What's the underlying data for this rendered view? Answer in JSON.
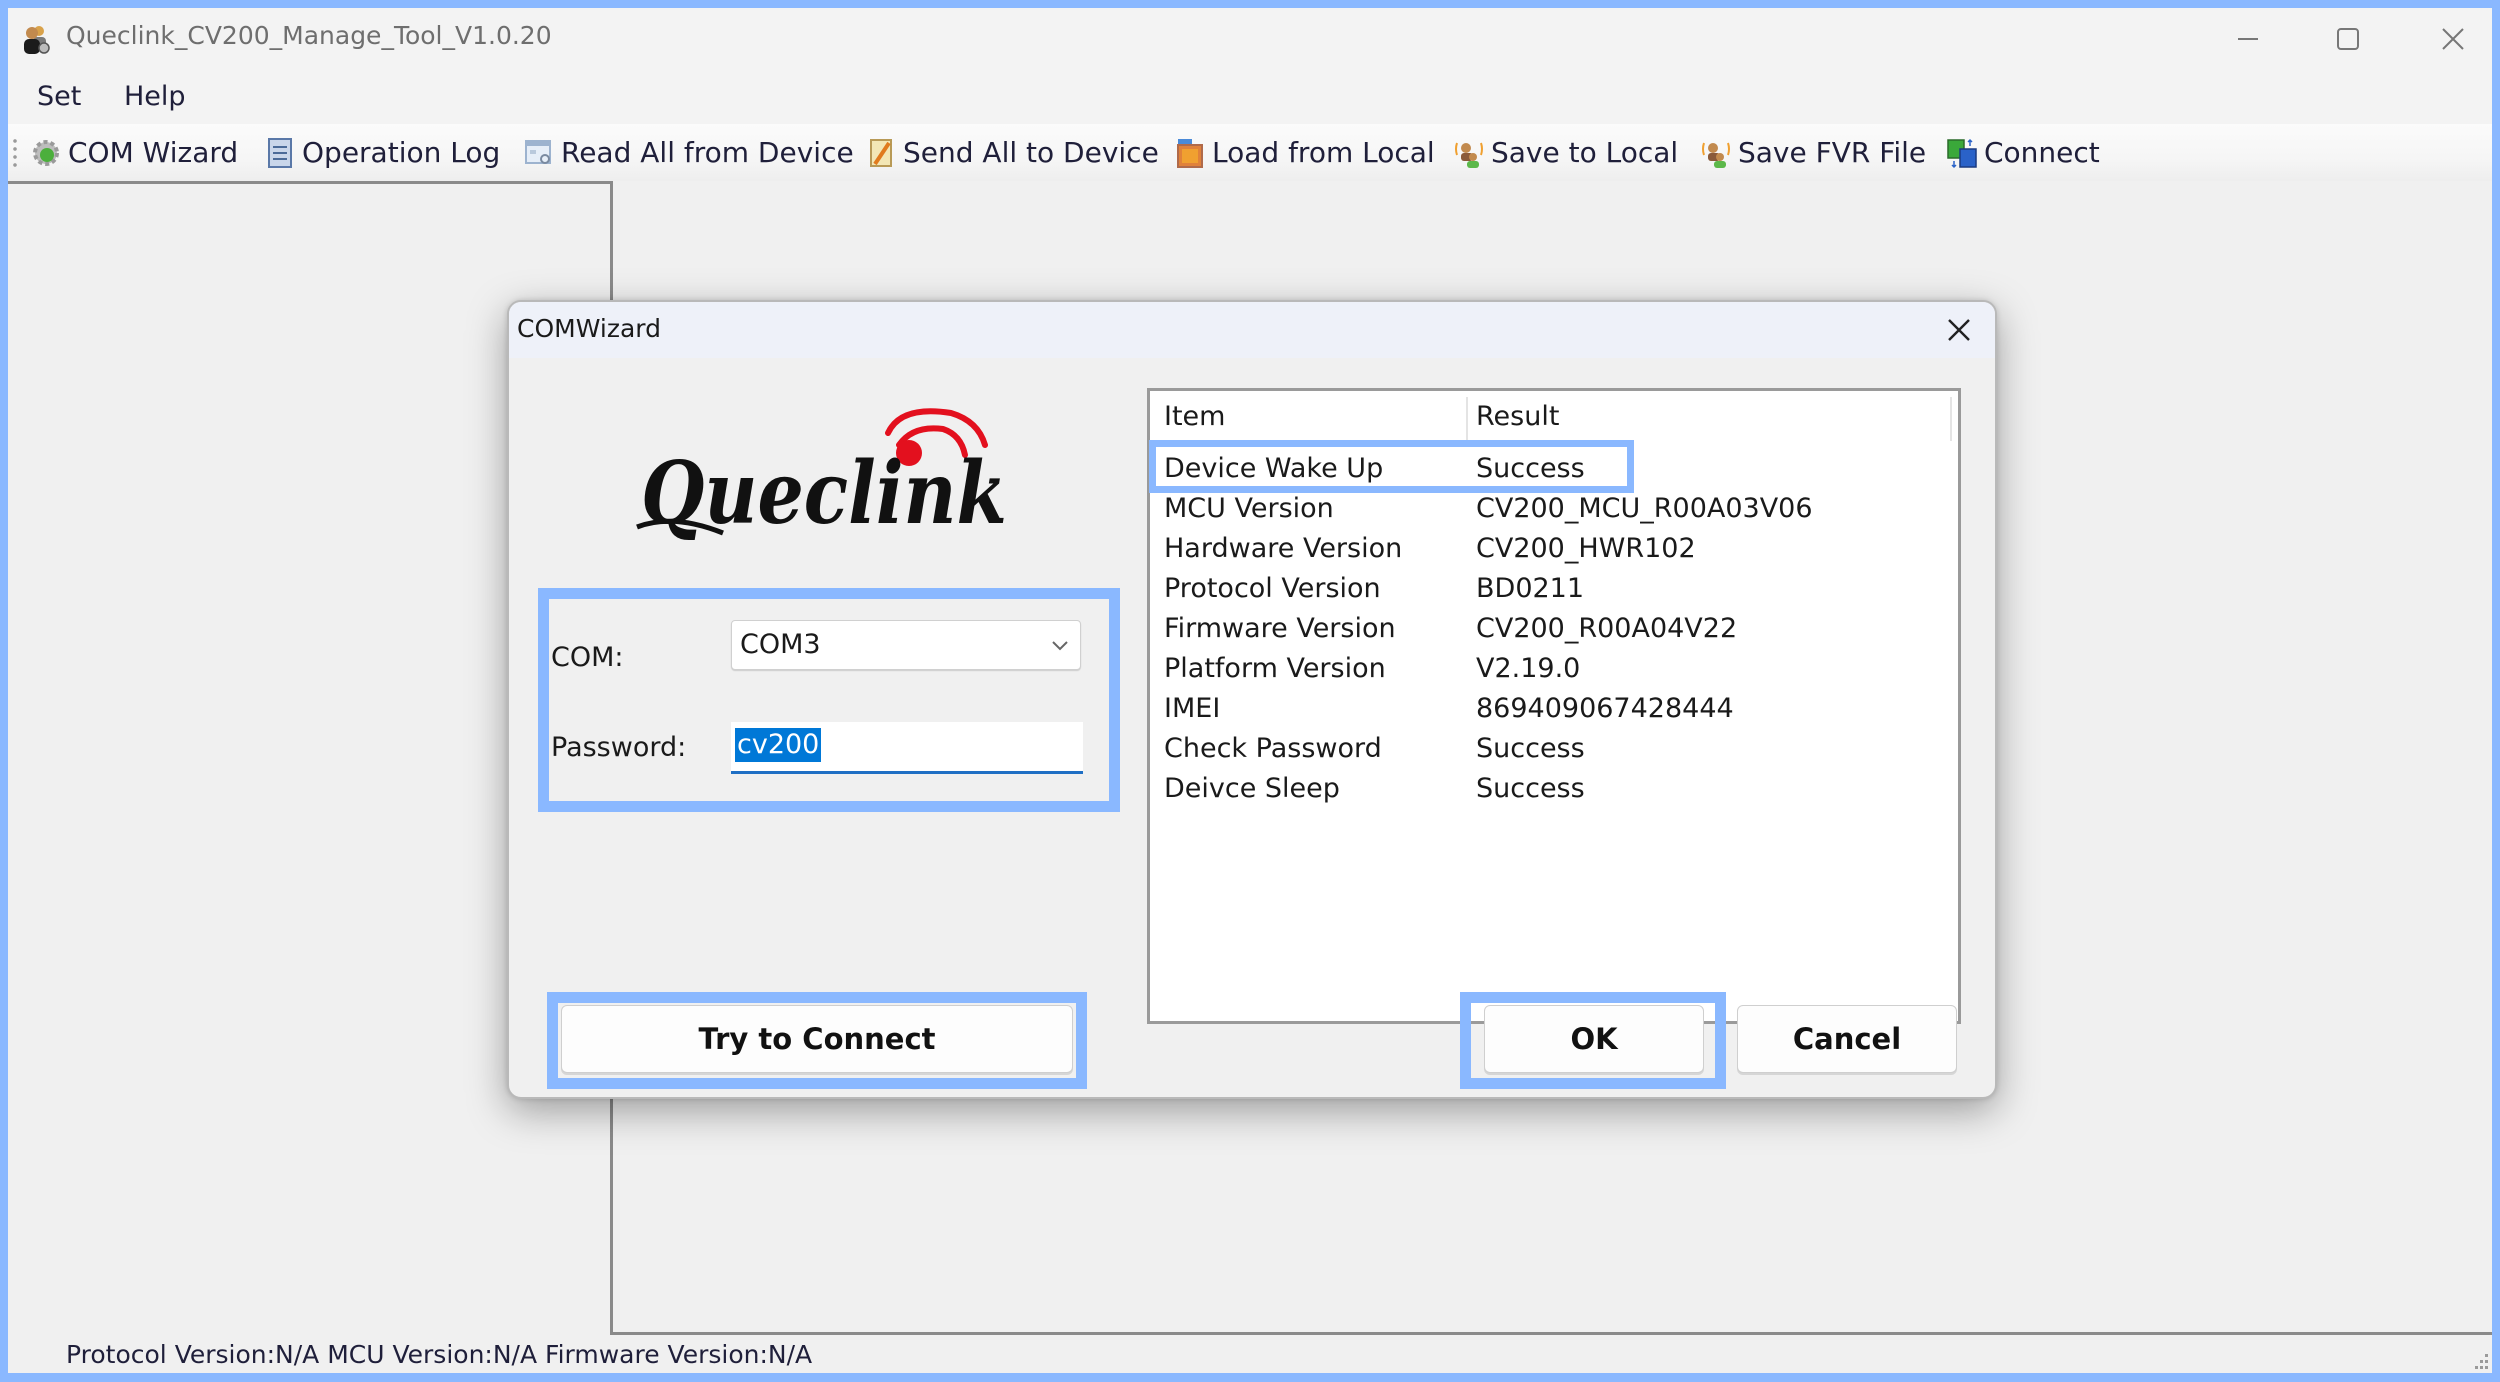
{
  "window": {
    "title": "Queclink_CV200_Manage_Tool_V1.0.20",
    "app_icon": "users-gear-icon",
    "controls": [
      "minimize-icon",
      "maximize-icon",
      "close-icon"
    ]
  },
  "menu": {
    "items": [
      {
        "label": "Set"
      },
      {
        "label": "Help"
      }
    ]
  },
  "toolbar": {
    "items": [
      {
        "label": "COM Wizard",
        "icon": "gear-wizard-icon"
      },
      {
        "label": "Operation Log",
        "icon": "log-scroll-icon"
      },
      {
        "label": "Read All from Device",
        "icon": "read-window-icon"
      },
      {
        "label": "Send All to Device",
        "icon": "send-notepad-icon"
      },
      {
        "label": "Load from Local",
        "icon": "load-image-icon"
      },
      {
        "label": "Save to Local",
        "icon": "save-users-icon"
      },
      {
        "label": "Save FVR File",
        "icon": "save-fvr-users-icon"
      },
      {
        "label": "Connect",
        "icon": "connect-swap-icon"
      }
    ]
  },
  "status_bar": {
    "text": "Protocol Version:N/A  MCU Version:N/A   Firmware Version:N/A"
  },
  "dialog": {
    "title": "COMWizard",
    "logo": {
      "text": "Queclink",
      "accent_color": "#e3101e"
    },
    "com_label": "COM:",
    "com_value": "COM3",
    "password_label": "Password:",
    "password_value": "cv200",
    "list": {
      "headers": [
        "Item",
        "Result"
      ],
      "rows": [
        {
          "item": "Device Wake Up",
          "result": "Success"
        },
        {
          "item": "MCU Version",
          "result": "CV200_MCU_R00A03V06"
        },
        {
          "item": "Hardware Version",
          "result": "CV200_HWR102"
        },
        {
          "item": "Protocol Version",
          "result": "BD0211"
        },
        {
          "item": "Firmware Version",
          "result": "CV200_R00A04V22"
        },
        {
          "item": "Platform Version",
          "result": "V2.19.0"
        },
        {
          "item": "IMEI",
          "result": "869409067428444"
        },
        {
          "item": "Check Password",
          "result": "Success"
        },
        {
          "item": "Deivce Sleep",
          "result": "Success"
        }
      ]
    },
    "buttons": {
      "try_connect": "Try to Connect",
      "ok": "OK",
      "cancel": "Cancel"
    }
  },
  "highlight_color": "#8ab8ff"
}
